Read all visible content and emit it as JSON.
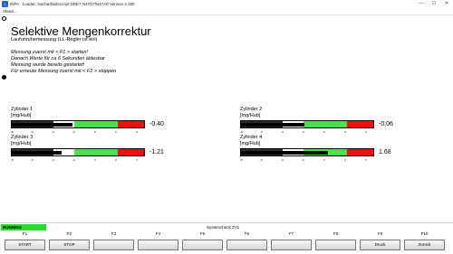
{
  "window": {
    "title": "INPA - Loader: Nacharbeitsscript DDE7 N47D7/N47A0 Version 4.100",
    "controls": [
      "—",
      "☐",
      "✕"
    ]
  },
  "menu": {
    "about": "About..."
  },
  "page": {
    "title": "Selektive Mengenkorrektur",
    "subtitle": "Laufunruhemessung (LL-Regler ist ein)",
    "instructions": [
      "Messung zuerst mit < F1 > starten!",
      "Danach Werte für ca 6 Sekunden ablesbar",
      "Messung wurde bereits gestartet!",
      "Für erneute Messung zuerst mit < F2 > stoppen"
    ]
  },
  "meters": [
    {
      "name": "Zylinder 1",
      "unit": "[mg/Hub]",
      "value": "-0.40",
      "fill_fraction": 0.46,
      "ticks": [
        "-8",
        "-6",
        "-4",
        "-2",
        "0",
        "2",
        "4"
      ]
    },
    {
      "name": "Zylinder 2",
      "unit": "[mg/Hub]",
      "value": "-0.06",
      "fill_fraction": 0.48,
      "ticks": [
        "-8",
        "-6",
        "-4",
        "-2",
        "0",
        "2",
        "4"
      ]
    },
    {
      "name": "Zylinder 3",
      "unit": "[mg/Hub]",
      "value": "-1.21",
      "fill_fraction": 0.38,
      "ticks": [
        "-8",
        "-6",
        "-4",
        "-2",
        "0",
        "2",
        "4"
      ]
    },
    {
      "name": "Zylinder 4",
      "unit": "[mg/Hub]",
      "value": "1.68",
      "fill_fraction": 0.66,
      "ticks": [
        "-8",
        "-6",
        "-4",
        "-2",
        "0",
        "2",
        "4"
      ]
    }
  ],
  "status": {
    "running": "RUNNING",
    "message": "Systemcheck ZYL"
  },
  "fkeys": [
    {
      "key": "F1",
      "label": "START"
    },
    {
      "key": "F2",
      "label": "STOP"
    },
    {
      "key": "F3",
      "label": ""
    },
    {
      "key": "F4",
      "label": ""
    },
    {
      "key": "F5",
      "label": ""
    },
    {
      "key": "F6",
      "label": ""
    },
    {
      "key": "F7",
      "label": ""
    },
    {
      "key": "F8",
      "label": ""
    },
    {
      "key": "F9",
      "label": "Druck"
    },
    {
      "key": "F10",
      "label": "Zurück"
    }
  ],
  "colors": {
    "running_green": "#2bd82b",
    "meter_green": "#4dde4d",
    "meter_red": "#f20d0d",
    "meter_dark": "#2d2d2d"
  }
}
